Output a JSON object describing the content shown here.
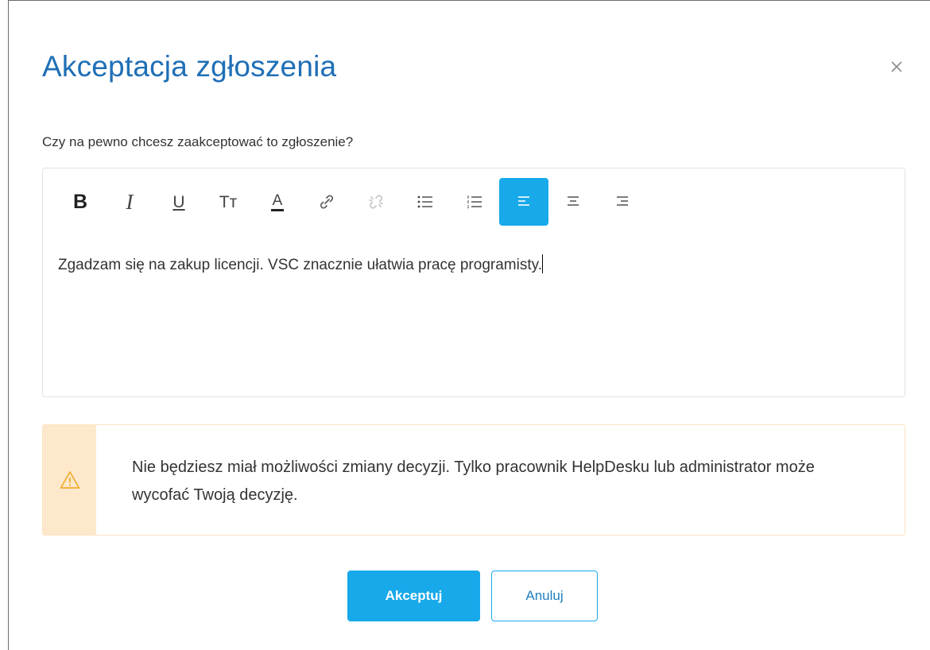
{
  "dialog": {
    "title": "Akceptacja zgłoszenia",
    "close_icon": "close-icon",
    "question": "Czy na pewno chcesz zaakceptować to zgłoszenie?"
  },
  "toolbar": {
    "buttons": [
      {
        "name": "bold",
        "icon": "bold-icon",
        "glyph": "B"
      },
      {
        "name": "italic",
        "icon": "italic-icon",
        "glyph": "I"
      },
      {
        "name": "underline",
        "icon": "underline-icon",
        "glyph": "U"
      },
      {
        "name": "font-size",
        "icon": "text-size-icon",
        "glyph": "Tт"
      },
      {
        "name": "font-color",
        "icon": "font-color-icon",
        "glyph": "A"
      },
      {
        "name": "link",
        "icon": "link-icon"
      },
      {
        "name": "unlink",
        "icon": "unlink-icon"
      },
      {
        "name": "bulleted-list",
        "icon": "bulleted-list-icon"
      },
      {
        "name": "numbered-list",
        "icon": "numbered-list-icon"
      },
      {
        "name": "align-left",
        "icon": "align-left-icon",
        "active": true
      },
      {
        "name": "align-center",
        "icon": "align-center-icon"
      },
      {
        "name": "align-right",
        "icon": "align-right-icon"
      }
    ]
  },
  "editor": {
    "text": "Zgadzam się na zakup licencji. VSC znacznie ułatwia pracę programisty."
  },
  "alert": {
    "icon": "warning-icon",
    "text": "Nie będziesz miał możliwości zmiany decyzji. Tylko pracownik HelpDesku lub administrator może wycofać Twoją decyzję."
  },
  "actions": {
    "accept_label": "Akceptuj",
    "cancel_label": "Anuluj"
  },
  "colors": {
    "accent": "#17a9ea",
    "title": "#1f6fb6",
    "alert_bg": "#fde8cc",
    "alert_border": "#fde3c2",
    "warning_icon": "#f0ad2b"
  }
}
